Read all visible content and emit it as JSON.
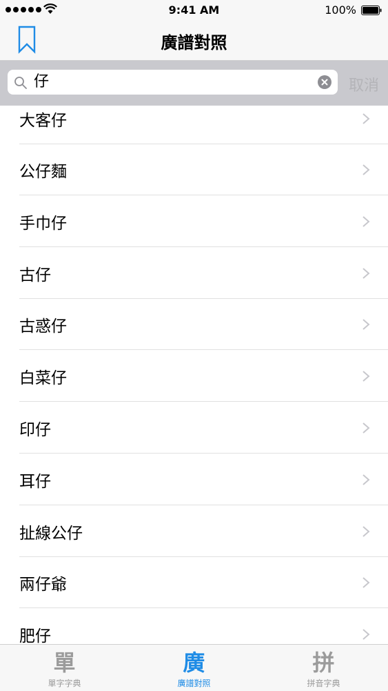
{
  "status_bar": {
    "time": "9:41 AM",
    "battery": "100%"
  },
  "nav": {
    "title": "廣譜對照"
  },
  "search": {
    "value": "仔",
    "cancel_label": "取消"
  },
  "list": {
    "items": [
      {
        "label": "大客仔"
      },
      {
        "label": "公仔麵"
      },
      {
        "label": "手巾仔"
      },
      {
        "label": "古仔"
      },
      {
        "label": "古惑仔"
      },
      {
        "label": "白菜仔"
      },
      {
        "label": "印仔"
      },
      {
        "label": "耳仔"
      },
      {
        "label": "扯線公仔"
      },
      {
        "label": "兩仔爺"
      },
      {
        "label": "肥仔"
      }
    ]
  },
  "tabs": [
    {
      "glyph": "單",
      "label": "單字字典",
      "active": false
    },
    {
      "glyph": "廣",
      "label": "廣譜對照",
      "active": true
    },
    {
      "glyph": "拼",
      "label": "拼音字典",
      "active": false
    }
  ],
  "colors": {
    "accent": "#1f8ce6",
    "inactive": "#9b9b9b",
    "search_bg": "#c9c9ce"
  }
}
